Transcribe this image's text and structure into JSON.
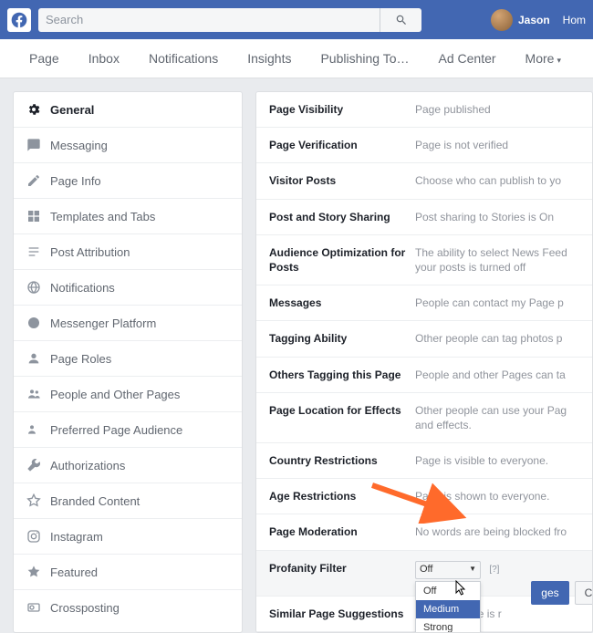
{
  "topbar": {
    "search_placeholder": "Search",
    "user_name": "Jason",
    "home_label": "Hom"
  },
  "nav": [
    "Page",
    "Inbox",
    "Notifications",
    "Insights",
    "Publishing To…",
    "Ad Center",
    "More"
  ],
  "sidebar": {
    "items": [
      {
        "icon": "gear",
        "label": "General",
        "active": true
      },
      {
        "icon": "message",
        "label": "Messaging"
      },
      {
        "icon": "pencil",
        "label": "Page Info"
      },
      {
        "icon": "templates",
        "label": "Templates and Tabs"
      },
      {
        "icon": "post",
        "label": "Post Attribution"
      },
      {
        "icon": "globe",
        "label": "Notifications"
      },
      {
        "icon": "chat",
        "label": "Messenger Platform"
      },
      {
        "icon": "person",
        "label": "Page Roles"
      },
      {
        "icon": "people",
        "label": "People and Other Pages"
      },
      {
        "icon": "audience",
        "label": "Preferred Page Audience"
      },
      {
        "icon": "wrench",
        "label": "Authorizations"
      },
      {
        "icon": "star-outline",
        "label": "Branded Content"
      },
      {
        "icon": "instagram",
        "label": "Instagram"
      },
      {
        "icon": "star",
        "label": "Featured"
      },
      {
        "icon": "crosspost",
        "label": "Crossposting"
      }
    ]
  },
  "settings": [
    {
      "label": "Page Visibility",
      "value": "Page published"
    },
    {
      "label": "Page Verification",
      "value": "Page is not verified"
    },
    {
      "label": "Visitor Posts",
      "value": "Choose who can publish to yo"
    },
    {
      "label": "Post and Story Sharing",
      "value": "Post sharing to Stories is On"
    },
    {
      "label": "Audience Optimization for Posts",
      "value": "The ability to select News Feed your posts is turned off"
    },
    {
      "label": "Messages",
      "value": "People can contact my Page p"
    },
    {
      "label": "Tagging Ability",
      "value": "Other people can tag photos p"
    },
    {
      "label": "Others Tagging this Page",
      "value": "People and other Pages can ta"
    },
    {
      "label": "Page Location for Effects",
      "value": "Other people can use your Pag and effects."
    },
    {
      "label": "Country Restrictions",
      "value": "Page is visible to everyone."
    },
    {
      "label": "Age Restrictions",
      "value": "Page is shown to everyone."
    },
    {
      "label": "Page Moderation",
      "value": "No words are being blocked fro"
    }
  ],
  "profanity": {
    "label": "Profanity Filter",
    "selected": "Off",
    "options": [
      "Off",
      "Medium",
      "Strong"
    ],
    "help": "[?]",
    "save_label": "ges",
    "cancel_label": "Cancel"
  },
  "similar": {
    "label": "Similar Page Suggestions",
    "value": "her your Page is r"
  }
}
